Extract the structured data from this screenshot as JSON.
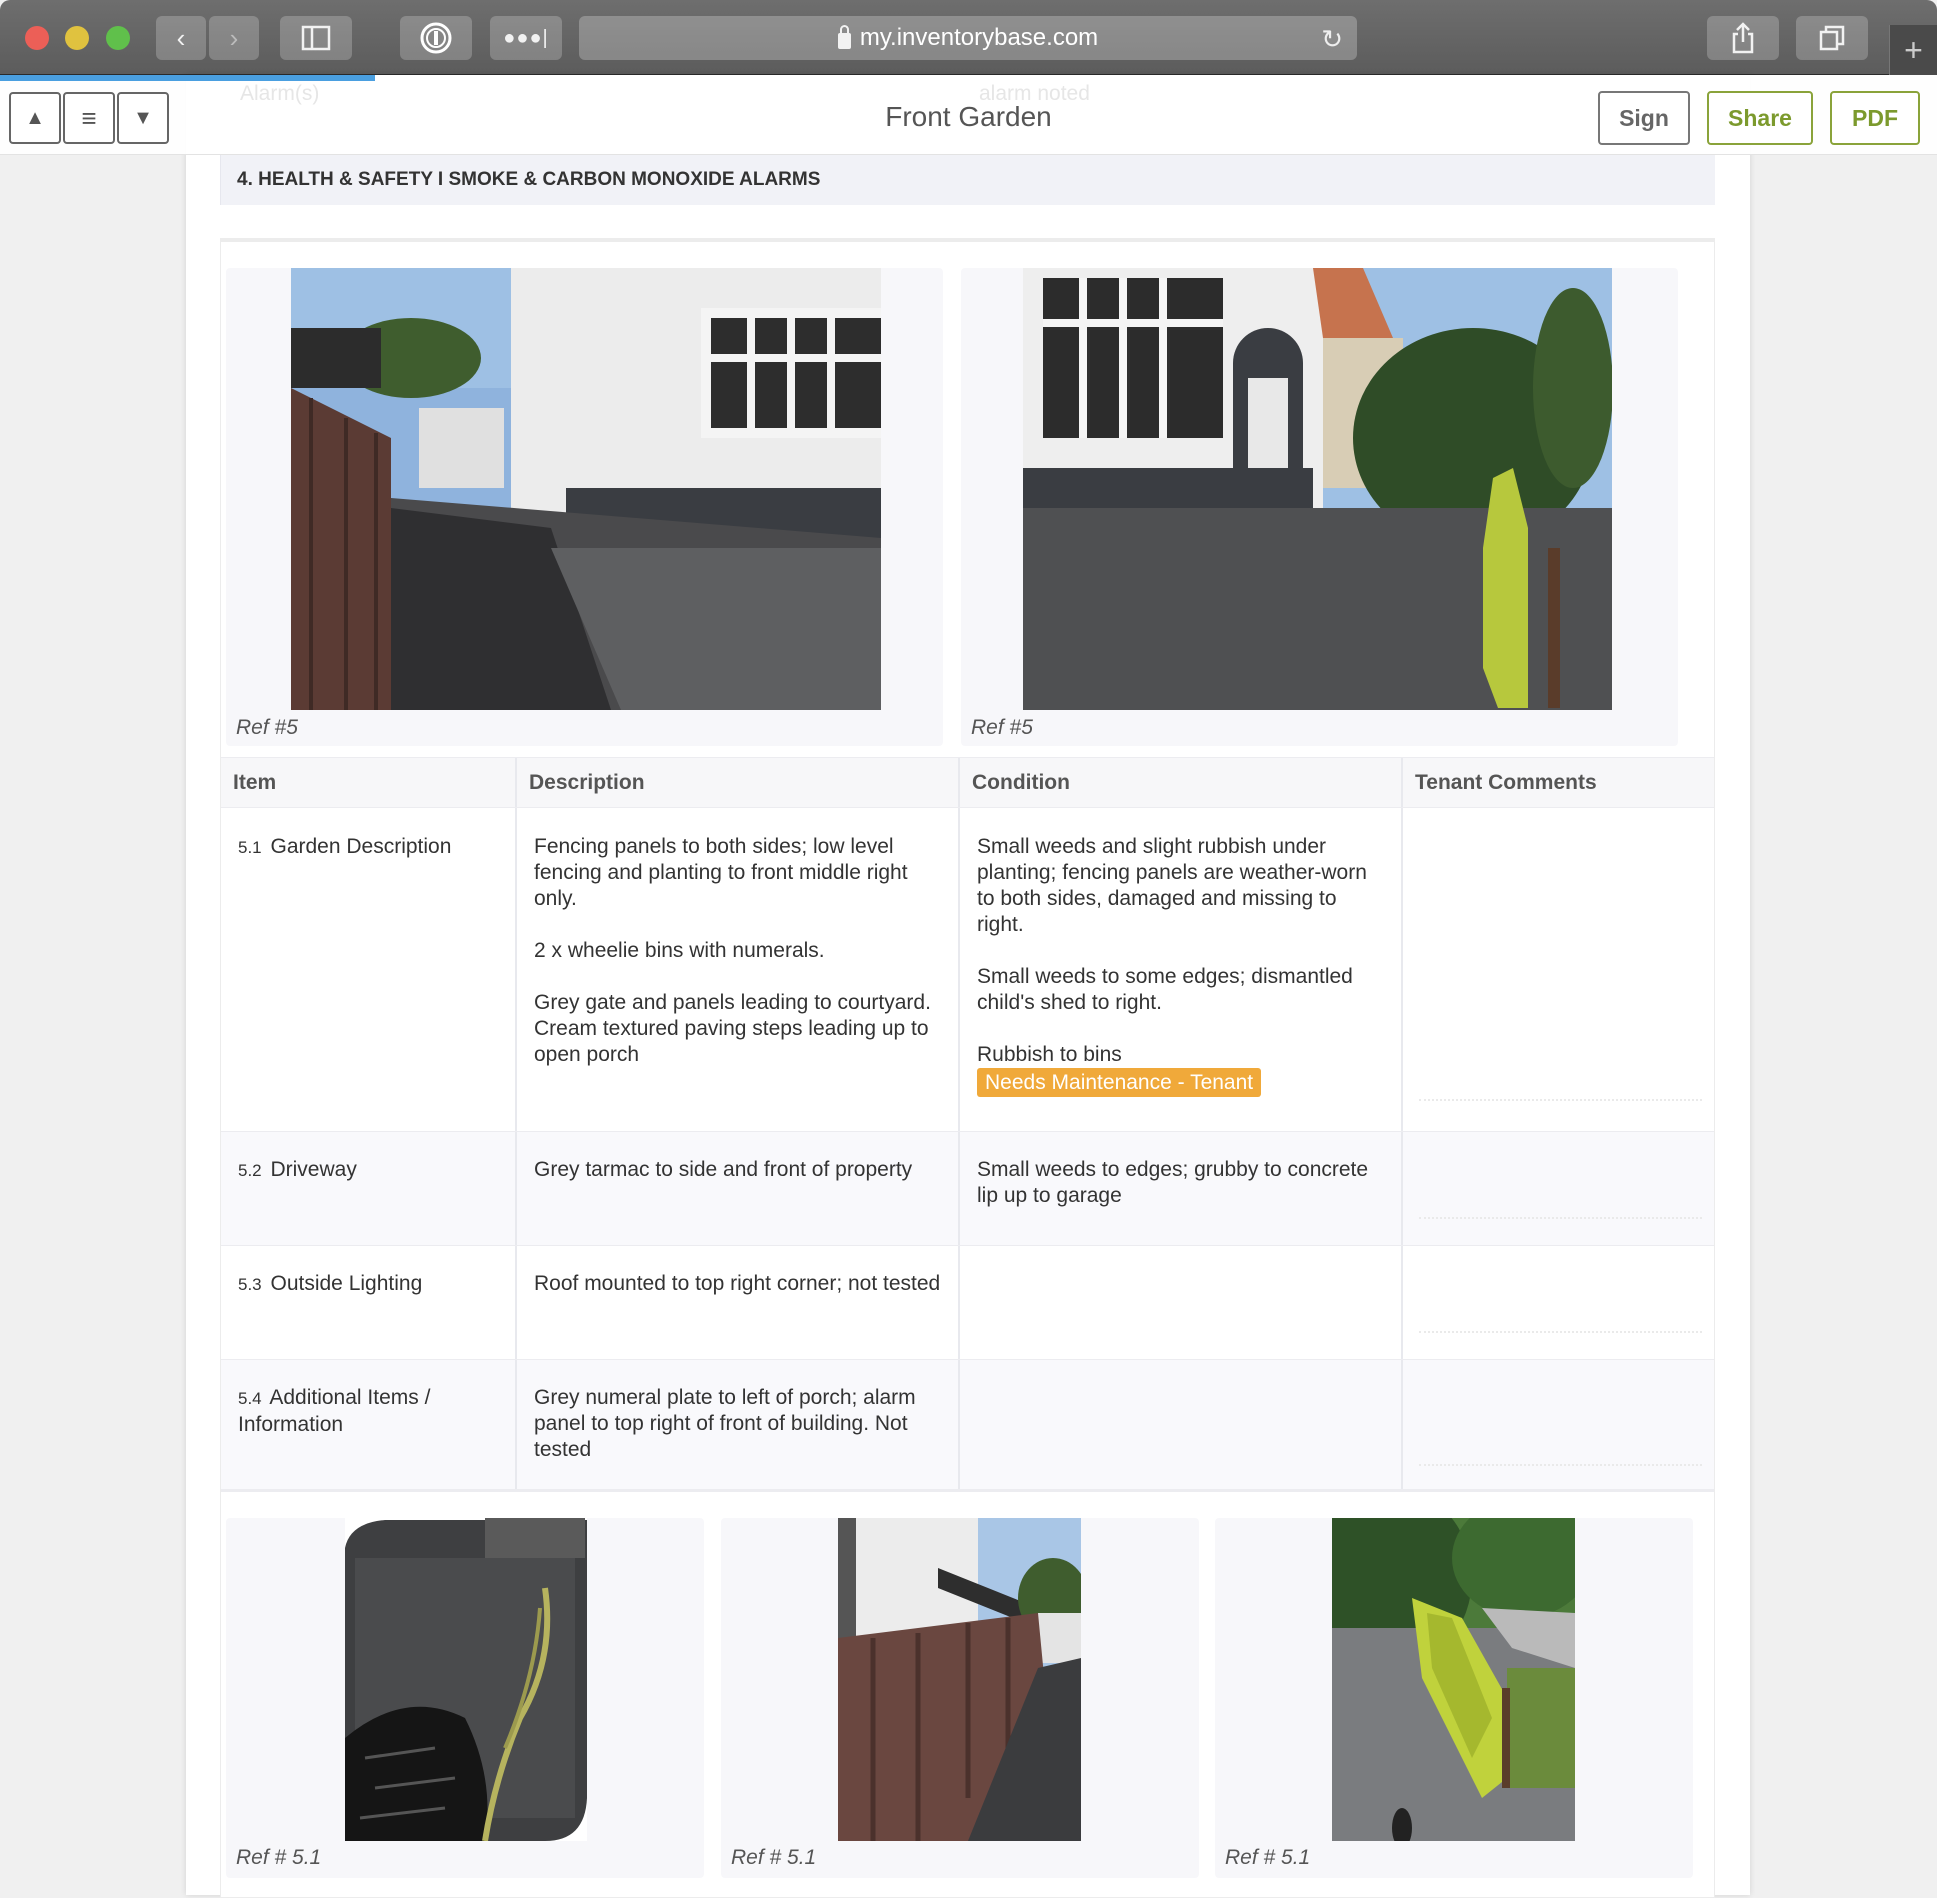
{
  "browser": {
    "url": "my.inventorybase.com",
    "icons": [
      "back-icon",
      "forward-icon",
      "sidebar-icon",
      "password-manager-icon",
      "extensions-icon",
      "reload-icon",
      "share-icon",
      "tabs-icon",
      "new-tab-icon"
    ]
  },
  "ghost_content": {
    "left": "Alarm(s)",
    "right": "alarm noted"
  },
  "header": {
    "title": "Front Garden",
    "nav": {
      "up": "▲",
      "menu": "≡",
      "down": "▼"
    },
    "sign_label": "Sign",
    "share_label": "Share",
    "pdf_label": "PDF"
  },
  "section": {
    "title": "4. HEALTH & SAFETY I SMOKE & CARBON MONOXIDE ALARMS"
  },
  "top_photos": [
    {
      "ref": "Ref #5",
      "alt": "Side driveway along fence toward garage"
    },
    {
      "ref": "Ref #5",
      "alt": "Front of house with porch and conifer"
    }
  ],
  "table": {
    "columns": [
      "Item",
      "Description",
      "Condition",
      "Tenant Comments"
    ],
    "rows": [
      {
        "num": "5.1",
        "item": "Garden Description",
        "description": [
          "Fencing panels to both sides; low level fencing and planting to front middle right only.",
          "2 x wheelie bins with numerals.",
          "Grey gate and panels leading to courtyard.",
          "Cream textured paving steps leading up to open porch"
        ],
        "condition": [
          "Small weeds and slight rubbish under planting; fencing panels are weather-worn to both sides, damaged and missing to right.",
          "Small weeds to some edges; dismantled child's shed to right.",
          "Rubbish to bins"
        ],
        "badge": "Needs Maintenance - Tenant",
        "tenant_comments": ""
      },
      {
        "num": "5.2",
        "item": "Driveway",
        "description": [
          "Grey tarmac to side and front of property"
        ],
        "condition": [
          "Small weeds to edges; grubby to concrete lip up to garage"
        ],
        "tenant_comments": ""
      },
      {
        "num": "5.3",
        "item": "Outside Lighting",
        "description": [
          "Roof mounted to top right corner; not tested"
        ],
        "condition": [],
        "tenant_comments": ""
      },
      {
        "num": "5.4",
        "item": "Additional Items / Information",
        "description": [
          "Grey numeral plate to left of porch; alarm panel to top right of front of building. Not tested"
        ],
        "condition": [],
        "tenant_comments": ""
      }
    ]
  },
  "bottom_photos": [
    {
      "ref": "Ref # 5.1",
      "alt": "Wheelie bin with rubbish bag"
    },
    {
      "ref": "Ref # 5.1",
      "alt": "Fence panels along side path"
    },
    {
      "ref": "Ref # 5.1",
      "alt": "Conifer hedge by driveway"
    }
  ],
  "colors": {
    "accent_green": "#7c9a2d",
    "badge_orange": "#f0a93a",
    "progress_blue": "#4a9fe0"
  }
}
